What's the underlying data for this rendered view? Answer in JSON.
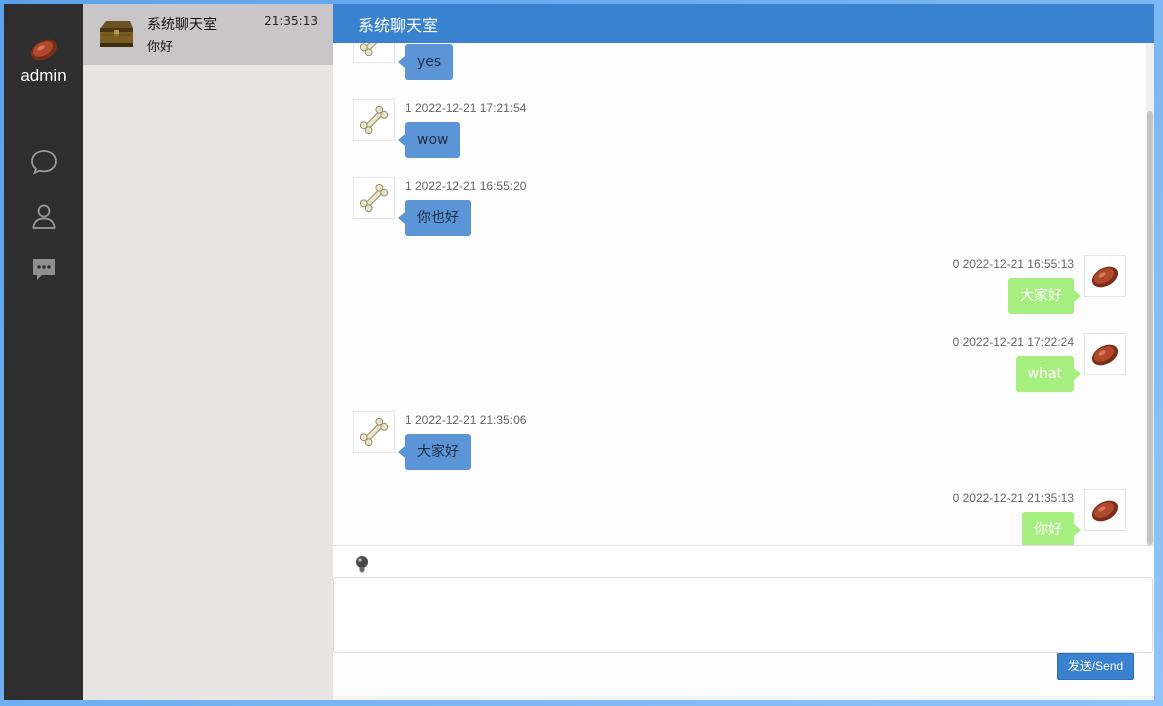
{
  "user": {
    "name": "admin",
    "avatar_icon": "steak-icon"
  },
  "nav": [
    {
      "icon": "chat-bubble-icon"
    },
    {
      "icon": "person-icon"
    },
    {
      "icon": "comment-icon"
    }
  ],
  "contacts": [
    {
      "name": "系统聊天室",
      "last_message": "你好",
      "time": "21:35:13",
      "icon": "treasure-chest-icon"
    }
  ],
  "chat": {
    "title": "系统聊天室",
    "messages": [
      {
        "side": "left",
        "meta": "",
        "text": "yes",
        "icon": "bone-icon"
      },
      {
        "side": "left",
        "meta": "1 2022-12-21 17:21:54",
        "text": "wow",
        "icon": "bone-icon"
      },
      {
        "side": "left",
        "meta": "1 2022-12-21 16:55:20",
        "text": "你也好",
        "icon": "bone-icon"
      },
      {
        "side": "right",
        "meta": "0 2022-12-21 16:55:13",
        "text": "大家好",
        "icon": "steak-icon"
      },
      {
        "side": "right",
        "meta": "0 2022-12-21 17:22:24",
        "text": "what",
        "icon": "steak-icon"
      },
      {
        "side": "left",
        "meta": "1 2022-12-21 21:35:06",
        "text": "大家好",
        "icon": "bone-icon"
      },
      {
        "side": "right",
        "meta": "0 2022-12-21 21:35:13",
        "text": "你好",
        "icon": "steak-icon"
      }
    ],
    "input_value": "",
    "send_label": "发送/Send",
    "emoji_icon": "lightbulb-icon"
  },
  "colors": {
    "header": "#3a82cf",
    "nav_bg": "#2e2e2e",
    "left_bubble": "#5b95d6",
    "right_bubble": "#a6ee7f"
  }
}
